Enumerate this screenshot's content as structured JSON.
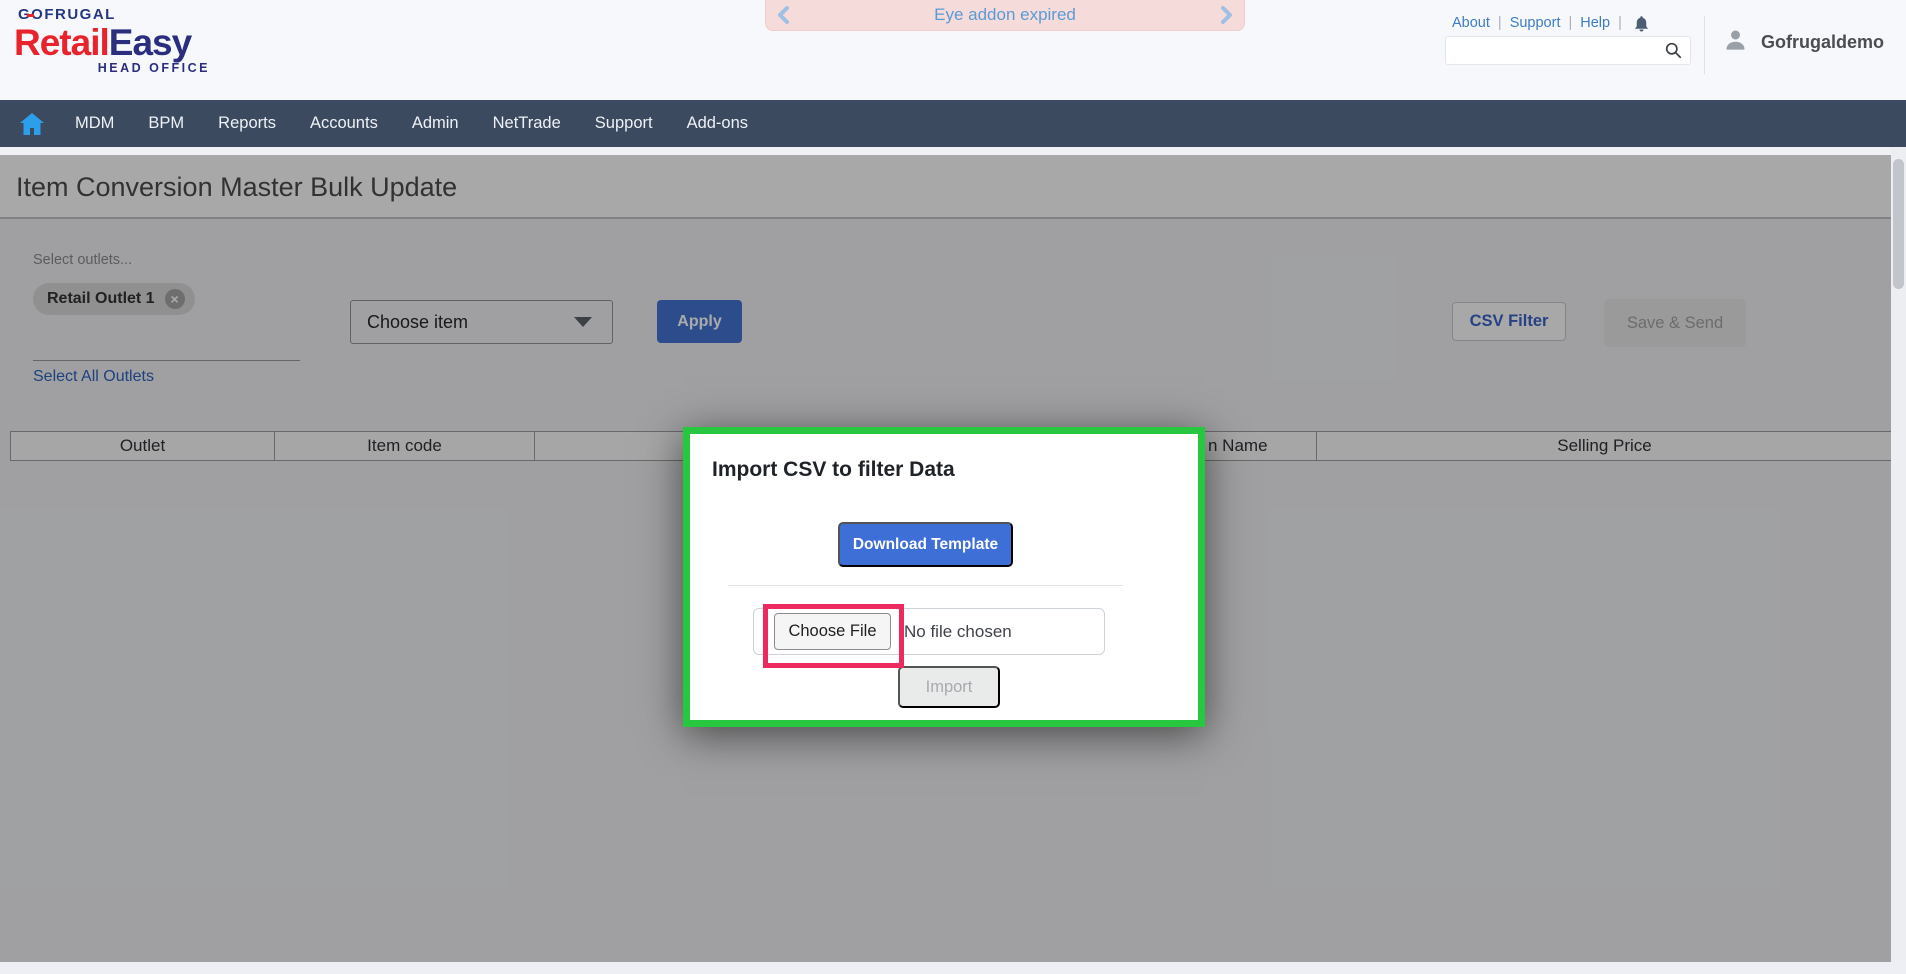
{
  "header": {
    "logo": {
      "brand": "GOFRUGAL",
      "product_red": "Retail",
      "product_blue": "Easy",
      "suffix": "HEAD OFFICE"
    },
    "banner": {
      "text": "Eye addon expired"
    },
    "links": [
      {
        "label": "About"
      },
      {
        "label": "Support"
      },
      {
        "label": "Help"
      }
    ],
    "search": {
      "value": ""
    },
    "user": {
      "name": "Gofrugaldemo"
    }
  },
  "nav": {
    "items": [
      "MDM",
      "BPM",
      "Reports",
      "Accounts",
      "Admin",
      "NetTrade",
      "Support",
      "Add-ons"
    ]
  },
  "page": {
    "title": "Item Conversion Master Bulk Update",
    "filters": {
      "outlets_label": "Select outlets...",
      "outlet_chip": "Retail Outlet 1",
      "select_all": "Select All Outlets",
      "item_dropdown": "Choose item",
      "apply": "Apply",
      "csv_filter": "CSV Filter",
      "save_send": "Save & Send"
    },
    "table": {
      "headers": [
        "Outlet",
        "Item code",
        "",
        "n Name",
        "Selling Price"
      ]
    }
  },
  "modal": {
    "title": "Import CSV to filter Data",
    "download_template": "Download Template",
    "choose_file": "Choose File",
    "no_file": "No file chosen",
    "import": "Import"
  },
  "ui": {
    "link_separator": "|",
    "close_glyph": "×"
  },
  "colors": {
    "accent_blue": "#3d6fd6",
    "apply_blue": "#4273d2",
    "nav_bg": "#3b4a5f",
    "modal_highlight_green": "#27c840",
    "annotation_pink": "#ed2a5f",
    "banner_bg": "#f6dbdb",
    "banner_text": "#5b9bd5",
    "link_blue": "#3e7cc3",
    "brand_red": "#e8262d",
    "brand_navy": "#2b2d7e"
  }
}
